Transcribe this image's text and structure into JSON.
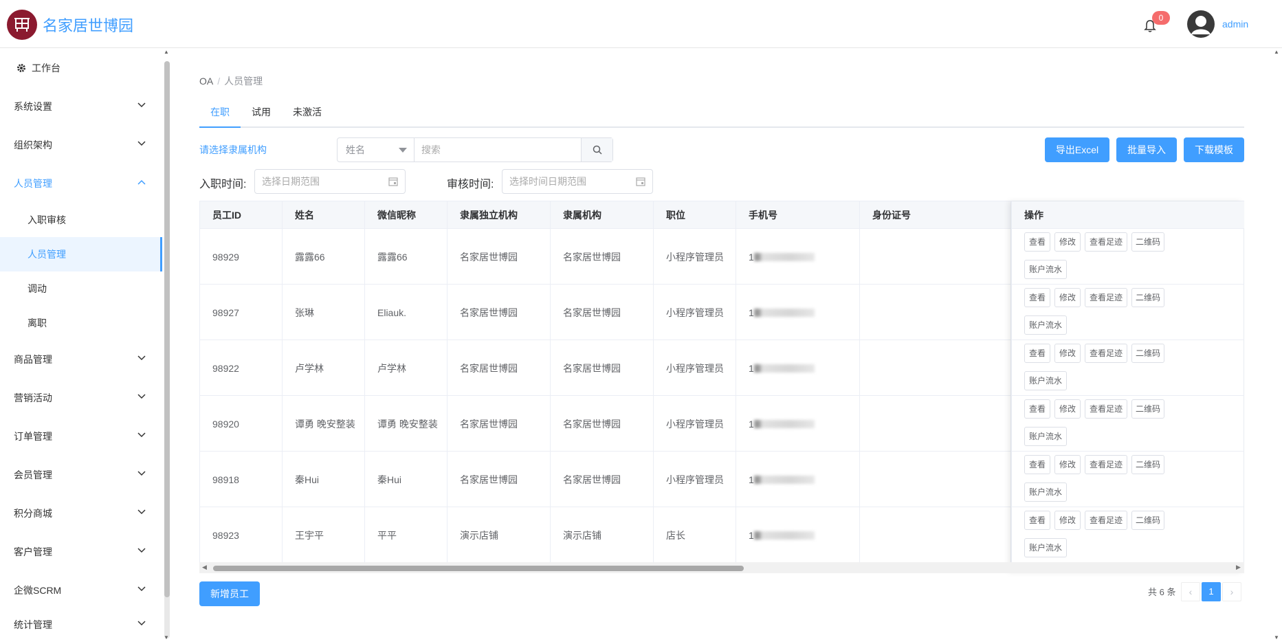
{
  "header": {
    "brand": "名家居世博园",
    "notification_count": "0",
    "username": "admin"
  },
  "sidebar": {
    "workbench": "工作台",
    "menus": [
      {
        "label": "系统设置",
        "icon": "chevron-down-icon"
      },
      {
        "label": "组织架构",
        "icon": "chevron-down-icon"
      },
      {
        "label": "人员管理",
        "icon": "chevron-up-icon"
      },
      {
        "label": "商品管理",
        "icon": "chevron-down-icon"
      },
      {
        "label": "营销活动",
        "icon": "chevron-down-icon"
      },
      {
        "label": "订单管理",
        "icon": "chevron-down-icon"
      },
      {
        "label": "会员管理",
        "icon": "chevron-down-icon"
      },
      {
        "label": "积分商城",
        "icon": "chevron-down-icon"
      },
      {
        "label": "客户管理",
        "icon": "chevron-down-icon"
      },
      {
        "label": "企微SCRM",
        "icon": "chevron-down-icon"
      },
      {
        "label": "统计管理",
        "icon": "chevron-down-icon"
      }
    ],
    "submenu": [
      "入职审核",
      "人员管理",
      "调动",
      "离职"
    ]
  },
  "breadcrumb": {
    "root": "OA",
    "separator": "/",
    "current": "人员管理"
  },
  "tabs": [
    "在职",
    "试用",
    "未激活"
  ],
  "filters": {
    "org_link": "请选择隶属机构",
    "search_field": "姓名",
    "search_placeholder": "搜索",
    "hire_time_label": "入职时间:",
    "hire_time_placeholder": "选择日期范围",
    "review_time_label": "审核时间:",
    "review_time_placeholder": "选择时间日期范围"
  },
  "actions": {
    "export": "导出Excel",
    "import": "批量导入",
    "template": "下载模板",
    "add": "新增员工"
  },
  "table": {
    "columns": [
      "员工ID",
      "姓名",
      "微信昵称",
      "隶属独立机构",
      "隶属机构",
      "职位",
      "手机号",
      "身份证号",
      "操作"
    ],
    "rows": [
      {
        "id": "98929",
        "name": "露露66",
        "wechat": "露露66",
        "org_independent": "名家居世博园",
        "org": "名家居世博园",
        "position": "小程序管理员",
        "phone": "1",
        "id_card": ""
      },
      {
        "id": "98927",
        "name": "张琳",
        "wechat": "Eliauk.",
        "org_independent": "名家居世博园",
        "org": "名家居世博园",
        "position": "小程序管理员",
        "phone": "1",
        "id_card": ""
      },
      {
        "id": "98922",
        "name": "卢学林",
        "wechat": "卢学林",
        "org_independent": "名家居世博园",
        "org": "名家居世博园",
        "position": "小程序管理员",
        "phone": "1",
        "id_card": ""
      },
      {
        "id": "98920",
        "name": "谭勇 晚安整装",
        "wechat": "谭勇 晚安整装",
        "org_independent": "名家居世博园",
        "org": "名家居世博园",
        "position": "小程序管理员",
        "phone": "1",
        "id_card": ""
      },
      {
        "id": "98918",
        "name": "秦Hui",
        "wechat": "秦Hui",
        "org_independent": "名家居世博园",
        "org": "名家居世博园",
        "position": "小程序管理员",
        "phone": "1",
        "id_card": ""
      },
      {
        "id": "98923",
        "name": "王宇平",
        "wechat": "平平",
        "org_independent": "演示店铺",
        "org": "演示店铺",
        "position": "店长",
        "phone": "1",
        "id_card": ""
      }
    ],
    "row_actions": [
      "查看",
      "修改",
      "查看足迹",
      "二维码",
      "账户流水"
    ]
  },
  "pagination": {
    "total": "共 6 条",
    "current_page": "1",
    "prev": "‹",
    "next": "›"
  },
  "colors": {
    "primary": "#409eff",
    "brand": "#8b1a2f",
    "badge": "#f56c6c"
  }
}
